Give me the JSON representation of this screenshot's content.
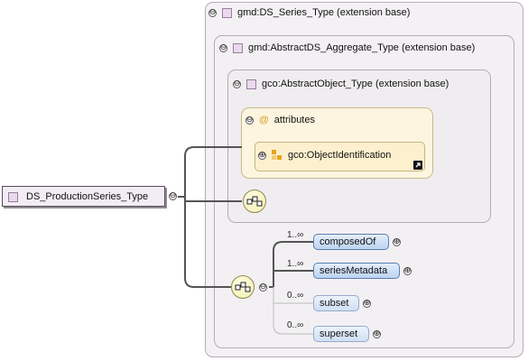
{
  "colors": {
    "connector": "#555555",
    "element_fill": "#c8dcf5",
    "extension_fill": "#f2eef2",
    "attributes_fill": "#fdf4dc"
  },
  "root": {
    "label": "DS_ProductionSeries_Type",
    "toggle": "⊖"
  },
  "extensions": [
    {
      "label": "gmd:DS_Series_Type (extension base)",
      "toggle": "⊖"
    },
    {
      "label": "gmd:AbstractDS_Aggregate_Type (extension base)",
      "toggle": "⊖"
    },
    {
      "label": "gco:AbstractObject_Type (extension base)",
      "toggle": "⊖"
    }
  ],
  "attributes": {
    "label": "attributes",
    "at_symbol": "@",
    "toggle": "⊖",
    "item": {
      "label": "gco:ObjectIdentification",
      "toggle": "⊕"
    }
  },
  "sequence": {
    "toggle": "⊖"
  },
  "children": [
    {
      "label": "composedOf",
      "cardinality": "1..∞",
      "toggle": "⊕",
      "optional": false
    },
    {
      "label": "seriesMetadata",
      "cardinality": "1..∞",
      "toggle": "⊕",
      "optional": false
    },
    {
      "label": "subset",
      "cardinality": "0..∞",
      "toggle": "⊕",
      "optional": true
    },
    {
      "label": "superset",
      "cardinality": "0..∞",
      "toggle": "⊕",
      "optional": true
    }
  ]
}
